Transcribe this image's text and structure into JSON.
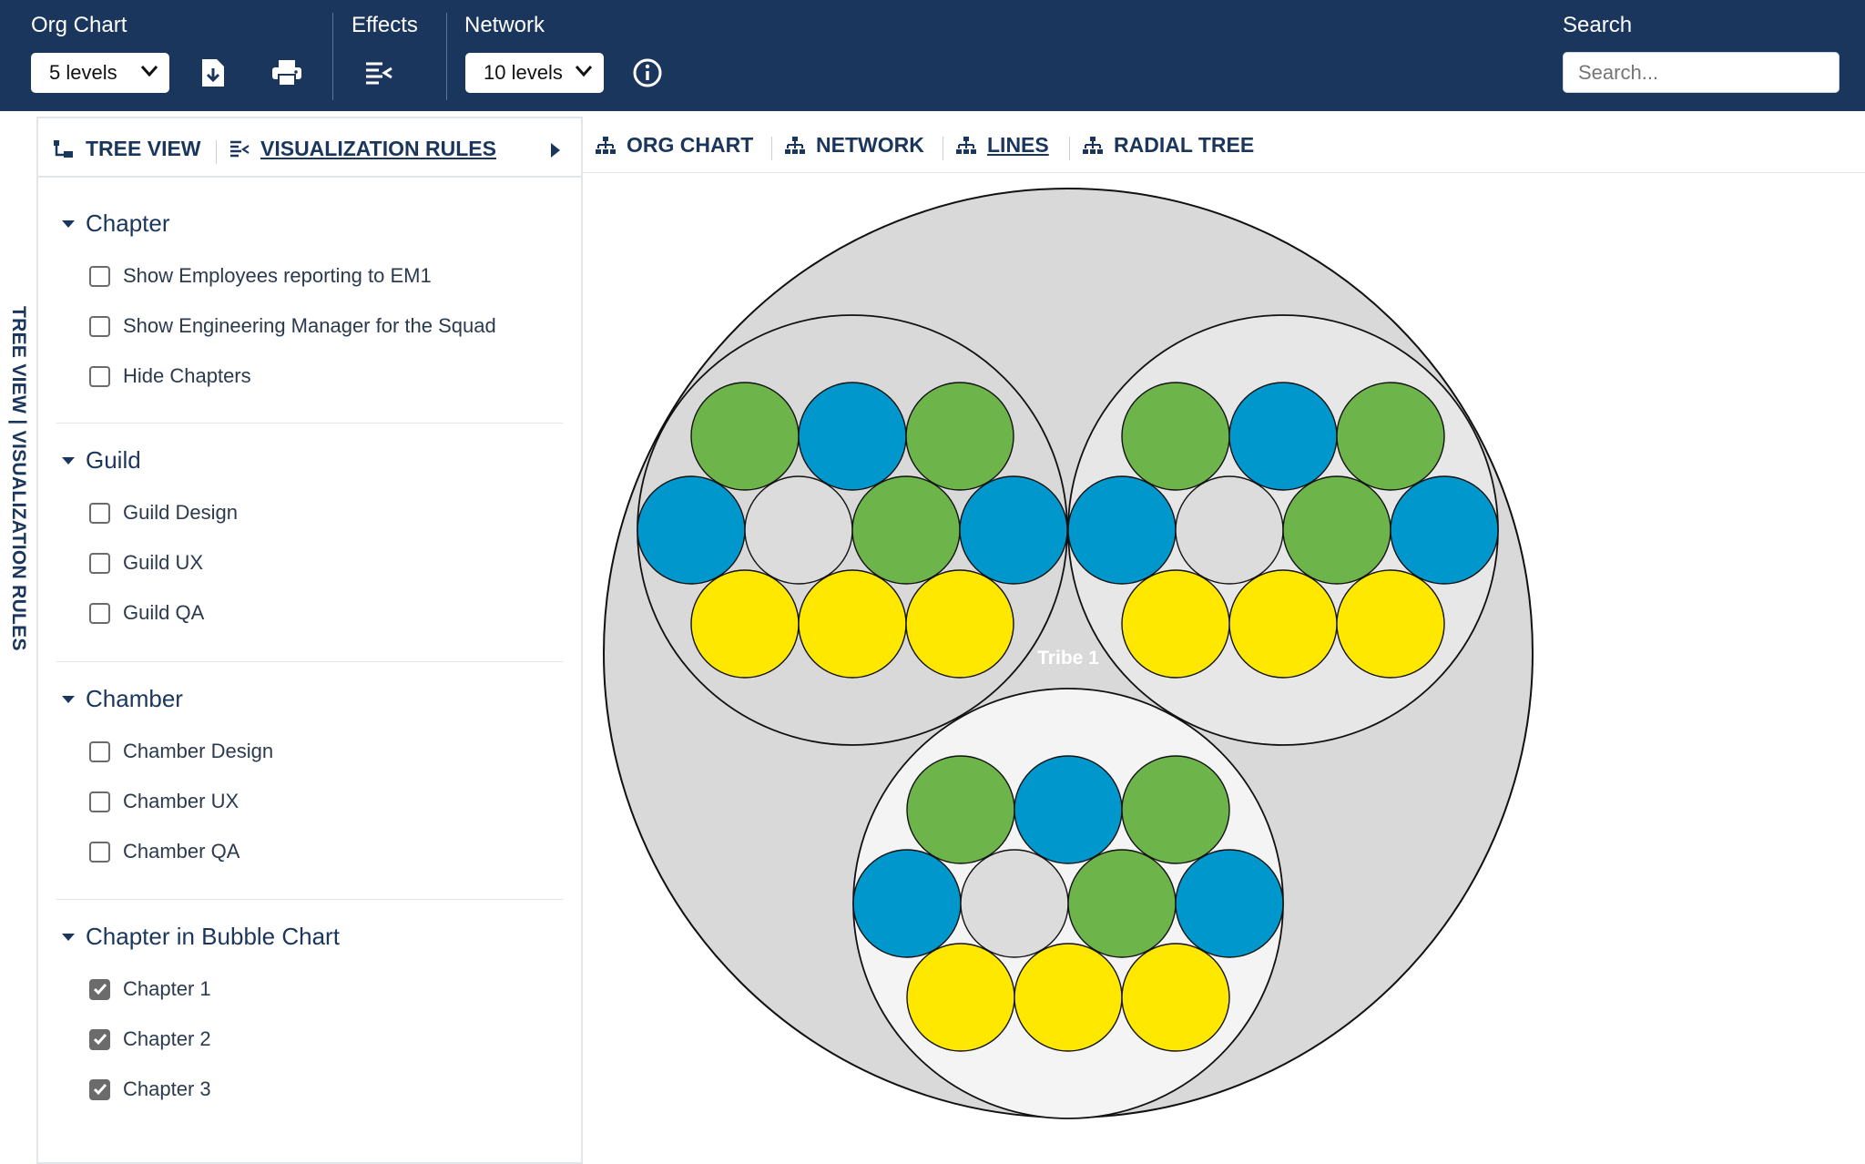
{
  "toolbar": {
    "org_chart_label": "Org Chart",
    "org_levels": "5 levels",
    "effects_label": "Effects",
    "network_label": "Network",
    "network_levels": "10 levels",
    "search_label": "Search",
    "search_placeholder": "Search..."
  },
  "rail": {
    "label": "TREE VIEW | VISUALIZATION RULES"
  },
  "panel": {
    "tabs": [
      {
        "label": "TREE VIEW",
        "icon": "tree-view-icon",
        "active": false
      },
      {
        "label": "VISUALIZATION RULES",
        "icon": "rules-icon",
        "active": true
      }
    ],
    "sections": [
      {
        "title": "Chapter",
        "items": [
          {
            "label": "Show Employees reporting to EM1",
            "checked": false
          },
          {
            "label": "Show Engineering Manager for the Squad",
            "checked": false
          },
          {
            "label": "Hide Chapters",
            "checked": false
          }
        ]
      },
      {
        "title": "Guild",
        "items": [
          {
            "label": "Guild Design",
            "checked": false
          },
          {
            "label": "Guild UX",
            "checked": false
          },
          {
            "label": "Guild QA",
            "checked": false
          }
        ]
      },
      {
        "title": "Chamber",
        "items": [
          {
            "label": "Chamber Design",
            "checked": false
          },
          {
            "label": "Chamber UX",
            "checked": false
          },
          {
            "label": "Chamber QA",
            "checked": false
          }
        ]
      },
      {
        "title": "Chapter in Bubble Chart",
        "items": [
          {
            "label": "Chapter 1",
            "checked": true
          },
          {
            "label": "Chapter 2",
            "checked": true
          },
          {
            "label": "Chapter 3",
            "checked": true
          }
        ]
      }
    ]
  },
  "view_tabs": [
    {
      "label": "ORG CHART",
      "active": false
    },
    {
      "label": "NETWORK",
      "active": false
    },
    {
      "label": "LINES",
      "active": true
    },
    {
      "label": "RADIAL TREE",
      "active": false
    }
  ],
  "colors": {
    "header_bg": "#1b365d",
    "green": "#6db54a",
    "blue": "#0097cd",
    "yellow": "#ffe800",
    "grey": "#dcdcdc",
    "tribe_fill": "#d9d9d9",
    "squad_fill": "#e7e7e7"
  },
  "bubble": {
    "tribe_label": "Tribe 1",
    "squads": [
      {
        "rows": [
          [
            "green",
            "blue",
            "green"
          ],
          [
            "blue",
            "grey",
            "green",
            "blue"
          ],
          [
            "yellow",
            "yellow",
            "yellow"
          ]
        ]
      },
      {
        "rows": [
          [
            "green",
            "blue",
            "green"
          ],
          [
            "blue",
            "grey",
            "green",
            "blue"
          ],
          [
            "yellow",
            "yellow",
            "yellow"
          ]
        ]
      },
      {
        "rows": [
          [
            "green",
            "blue",
            "green"
          ],
          [
            "blue",
            "grey",
            "green",
            "blue"
          ],
          [
            "yellow",
            "yellow",
            "yellow"
          ]
        ]
      }
    ]
  }
}
